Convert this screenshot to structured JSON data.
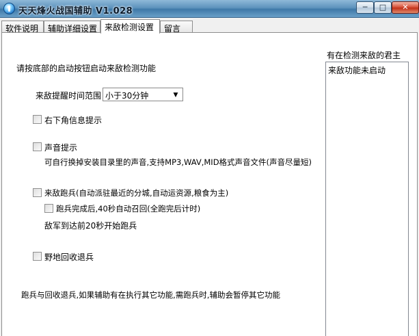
{
  "window": {
    "title": "天天烽火战国辅助 V1.028",
    "minimize_glyph": "─",
    "maximize_glyph": "□",
    "close_glyph": "✕"
  },
  "tabs": [
    {
      "label": "软件说明",
      "active": false
    },
    {
      "label": "辅助详细设置",
      "active": false
    },
    {
      "label": "来敌检测设置",
      "active": true
    },
    {
      "label": "留言",
      "active": false
    }
  ],
  "panel": {
    "instruction": "请按底部的启动按钮启动来敌检测功能",
    "reminder_range_label": "来敌提醒时间范围",
    "reminder_range_value": "小于30分钟",
    "option_bottom_right_info": "右下角信息提示",
    "option_sound": "声音提示",
    "sound_note": "可自行换掉安装目录里的声音,支持MP3,WAV,MID格式声音文件(声音尽量短)",
    "option_flee": "来敌跑兵(自动派驻最近的分城,自动运资源,粮食为主)",
    "option_recall": "跑兵完成后,40秒自动召回(全跑完后计时)",
    "flee_note": "敌军到达前20秒开始跑兵",
    "option_field_recall": "野地回收退兵",
    "footer_note": "跑兵与回收退兵,如果辅助有在执行其它功能,需跑兵时,辅助会暂停其它功能"
  },
  "right_panel": {
    "title": "有在检测来敌的君主",
    "items": [
      "来敌功能未启动"
    ]
  },
  "icons": {
    "app": "app-icon",
    "dropdown": "chevron-down-icon"
  }
}
